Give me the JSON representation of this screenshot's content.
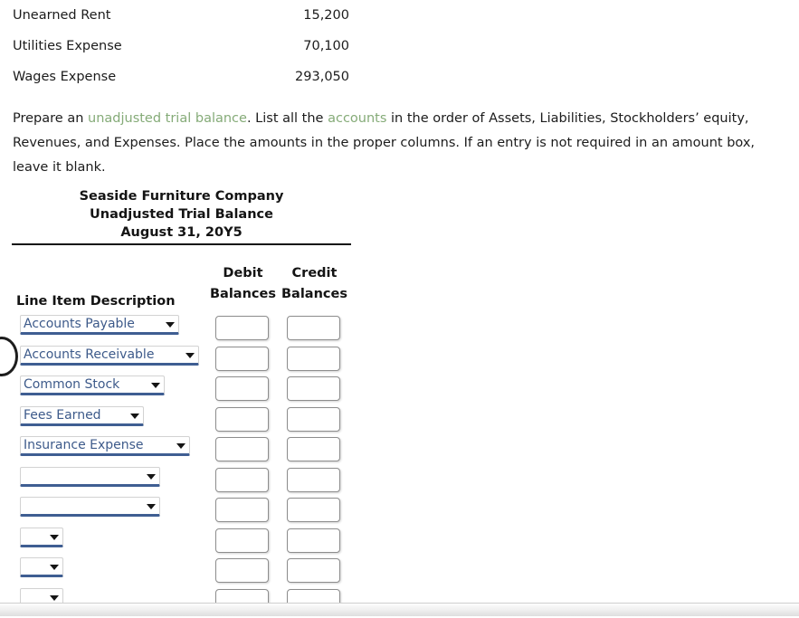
{
  "account_rows": [
    {
      "name": "Unearned Rent",
      "amount": "15,200"
    },
    {
      "name": "Utilities Expense",
      "amount": "70,100"
    },
    {
      "name": "Wages Expense",
      "amount": "293,050"
    }
  ],
  "instructions": {
    "part1": "Prepare an ",
    "link1": "unadjusted trial balance",
    "part2": ". List all the ",
    "link2": "accounts",
    "part3": " in the order of Assets, Liabilities, Stockholders’ equity, Revenues, and Expenses. Place the amounts in the proper columns. If an entry is not required in an amount box, leave it blank.",
    "link_color": "#85ab78"
  },
  "statement": {
    "company": "Seaside Furniture Company",
    "title": "Unadjusted Trial Balance",
    "date": "August 31, 20Y5"
  },
  "columns": {
    "line_item": "Line Item Description",
    "debit_line1": "Debit",
    "debit_line2": "Balances",
    "credit_line1": "Credit",
    "credit_line2": "Balances"
  },
  "rows": [
    {
      "account": "Accounts Payable",
      "select_width": 176,
      "debit": "",
      "credit": ""
    },
    {
      "account": "Accounts Receivable",
      "select_width": 198,
      "debit": "",
      "credit": ""
    },
    {
      "account": "Common Stock",
      "select_width": 160,
      "debit": "",
      "credit": ""
    },
    {
      "account": "Fees Earned",
      "select_width": 137,
      "debit": "",
      "credit": ""
    },
    {
      "account": "Insurance Expense",
      "select_width": 188,
      "debit": "",
      "credit": ""
    },
    {
      "account": "",
      "select_width": 155,
      "debit": "",
      "credit": ""
    },
    {
      "account": "",
      "select_width": 155,
      "debit": "",
      "credit": ""
    },
    {
      "account": "",
      "select_width": 48,
      "debit": "",
      "credit": ""
    },
    {
      "account": "",
      "select_width": 48,
      "debit": "",
      "credit": ""
    },
    {
      "account": "",
      "select_width": 48,
      "debit": "",
      "credit": ""
    }
  ]
}
